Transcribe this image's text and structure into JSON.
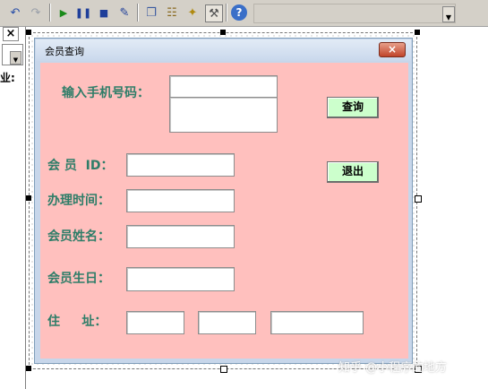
{
  "toolbar": {
    "icons": [
      "undo-icon",
      "redo-icon",
      "run-icon",
      "pause-icon",
      "stop-icon",
      "design-mode-icon",
      "project-explorer-icon",
      "properties-icon",
      "object-browser-icon",
      "toolbox-icon",
      "help-icon"
    ]
  },
  "left_panel": {
    "close_glyph": "×",
    "label": "业:"
  },
  "form": {
    "title": "会员查询",
    "close_glyph": "×",
    "phone_label": "输入手机号码：",
    "query_button": "查询",
    "exit_button": "退出",
    "member_id_label": "会 员  ID：",
    "join_time_label": "办理时间：",
    "member_name_label": "会员姓名：",
    "birthday_label": "会员生日：",
    "address_label": "住     址："
  },
  "watermark": "知乎 @小程序的地方",
  "colors": {
    "form_background": "#ffc0be",
    "label_color": "#2e7d68",
    "button_color": "#ccffcc"
  }
}
